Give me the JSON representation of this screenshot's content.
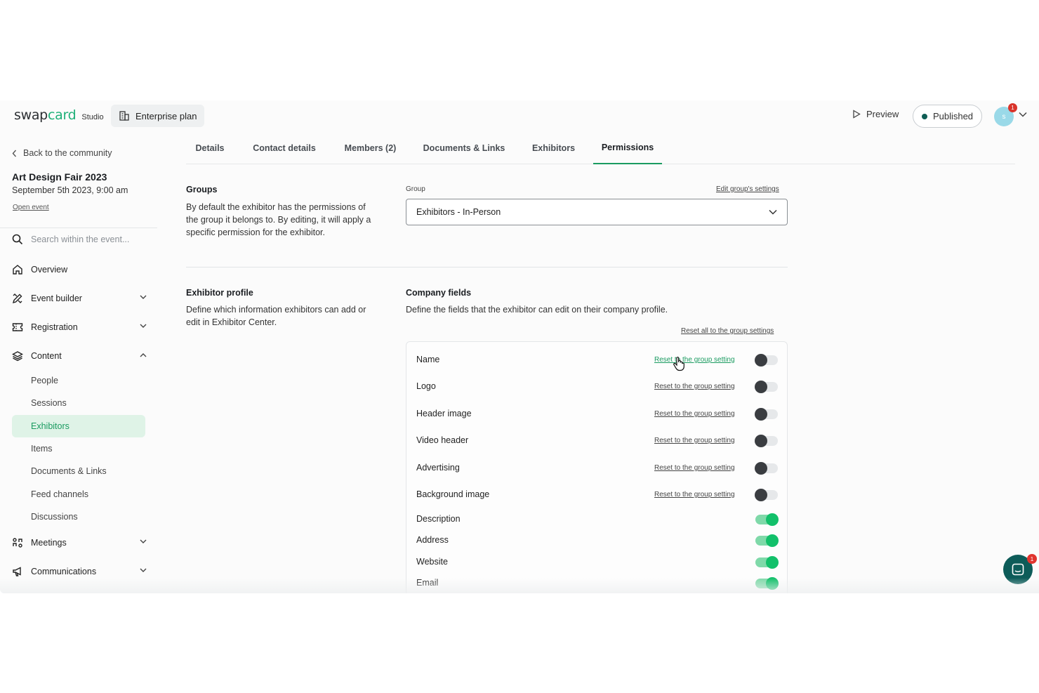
{
  "header": {
    "logo_main": "swap",
    "logo_accent": "card",
    "logo_sub": "Studio",
    "plan": "Enterprise plan",
    "preview": "Preview",
    "published": "Published",
    "avatar_initial": "s",
    "notification_count": "1"
  },
  "sidebar": {
    "back": "Back to the community",
    "event_title": "Art Design Fair 2023",
    "event_date": "September 5th 2023, 9:00 am",
    "open_event": "Open event",
    "search_placeholder": "Search within the event...",
    "nav": {
      "overview": "Overview",
      "event_builder": "Event builder",
      "registration": "Registration",
      "content": "Content",
      "meetings": "Meetings",
      "communications": "Communications"
    },
    "content_items": [
      "People",
      "Sessions",
      "Exhibitors",
      "Items",
      "Documents & Links",
      "Feed channels",
      "Discussions"
    ],
    "active_item": "Exhibitors"
  },
  "tabs": [
    "Details",
    "Contact details",
    "Members (2)",
    "Documents & Links",
    "Exhibitors",
    "Permissions"
  ],
  "active_tab": "Permissions",
  "groups": {
    "title": "Groups",
    "description": "By default the exhibitor has the permissions of the group it belongs to. By editing, it will apply a specific permission for the exhibitor.",
    "field_label": "Group",
    "edit_link": "Edit group's settings",
    "selected": "Exhibitors - In-Person"
  },
  "exhibitor_profile": {
    "title": "Exhibitor profile",
    "description": "Define which information exhibitors can add or edit in Exhibitor Center."
  },
  "company_fields": {
    "title": "Company fields",
    "description": "Define the fields that the exhibitor can edit on their company profile.",
    "reset_all": "Reset all to the group settings",
    "reset_label": "Reset to the group setting",
    "fields": [
      {
        "name": "Name",
        "reset": true,
        "enabled": false
      },
      {
        "name": "Logo",
        "reset": true,
        "enabled": false
      },
      {
        "name": "Header image",
        "reset": true,
        "enabled": false
      },
      {
        "name": "Video header",
        "reset": true,
        "enabled": false
      },
      {
        "name": "Advertising",
        "reset": true,
        "enabled": false
      },
      {
        "name": "Background image",
        "reset": true,
        "enabled": false
      },
      {
        "name": "Description",
        "reset": false,
        "enabled": true
      },
      {
        "name": "Address",
        "reset": false,
        "enabled": true
      },
      {
        "name": "Website",
        "reset": false,
        "enabled": true
      },
      {
        "name": "Email",
        "reset": false,
        "enabled": true
      }
    ]
  },
  "chat": {
    "badge": "1"
  },
  "colors": {
    "accent": "#1a9b60",
    "toggle_on": "#12c06a",
    "chat": "#0d5c59"
  }
}
